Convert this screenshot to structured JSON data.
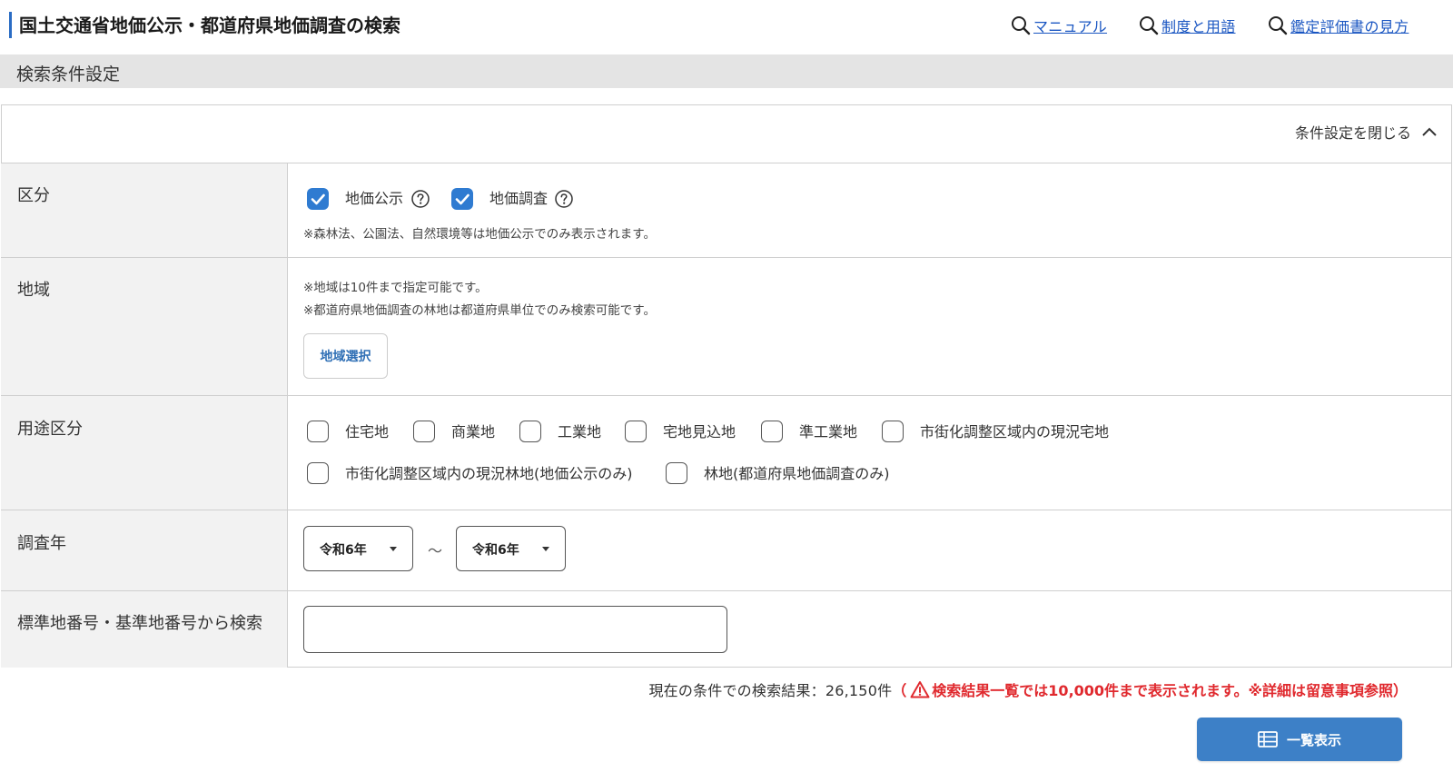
{
  "header": {
    "title": "国土交通省地価公示・都道府県地価調査の検索",
    "links": [
      {
        "label": "マニュアル",
        "icon": "search-icon"
      },
      {
        "label": "制度と用語",
        "icon": "search-icon"
      },
      {
        "label": "鑑定評価書の見方",
        "icon": "search-icon"
      }
    ]
  },
  "section": {
    "title": "検索条件設定"
  },
  "panel": {
    "toggle_label": "条件設定を閉じる",
    "toggle_icon": "chevron-up-icon"
  },
  "rows": {
    "category": {
      "label": "区分",
      "options": [
        {
          "label": "地価公示",
          "checked": true
        },
        {
          "label": "地価調査",
          "checked": true
        }
      ],
      "note": "※森林法、公園法、自然環境等は地価公示でのみ表示されます。"
    },
    "region": {
      "label": "地域",
      "notes": [
        "※地域は10件まで指定可能です。",
        "※都道府県地価調査の林地は都道府県単位でのみ検索可能です。"
      ],
      "button_label": "地域選択"
    },
    "usage": {
      "label": "用途区分",
      "options": [
        {
          "label": "住宅地",
          "checked": false
        },
        {
          "label": "商業地",
          "checked": false
        },
        {
          "label": "工業地",
          "checked": false
        },
        {
          "label": "宅地見込地",
          "checked": false
        },
        {
          "label": "準工業地",
          "checked": false
        },
        {
          "label": "市街化調整区域内の現況宅地",
          "checked": false
        },
        {
          "label": "市街化調整区域内の現況林地(地価公示のみ)",
          "checked": false
        },
        {
          "label": "林地(都道府県地価調査のみ)",
          "checked": false
        }
      ]
    },
    "year": {
      "label": "調査年",
      "from": "令和6年",
      "separator": "～",
      "to": "令和6年"
    },
    "number_search": {
      "label": "標準地番号・基準地番号から検索",
      "value": "",
      "placeholder": ""
    }
  },
  "result": {
    "count_text": "現在の条件での検索結果：26,150件",
    "warning_open": "（",
    "warning_text": "検索結果一覧では10,000件まで表示されます。※詳細は留意事項参照）",
    "warning_icon": "warning-triangle-icon"
  },
  "list_button": {
    "label": "一覧表示",
    "icon": "table-list-icon"
  },
  "colors": {
    "link": "#1a56c2",
    "accent": "#2f7bd1",
    "title_bar": "#2a6cc4",
    "warning": "#e0292e",
    "list_button": "#3d80c7"
  }
}
